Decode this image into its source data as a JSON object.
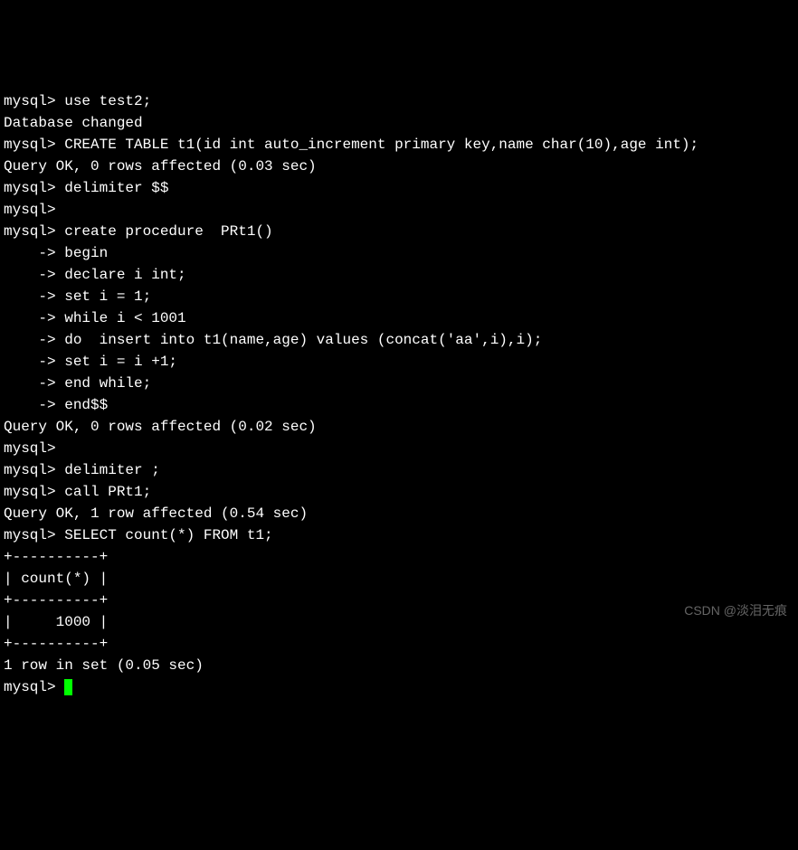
{
  "terminal": {
    "lines": [
      "mysql> use test2;",
      "Database changed",
      "mysql> CREATE TABLE t1(id int auto_increment primary key,name char(10),age int);",
      "Query OK, 0 rows affected (0.03 sec)",
      "",
      "mysql> delimiter $$",
      "mysql>",
      "mysql> create procedure  PRt1()",
      "    -> begin",
      "    -> declare i int;",
      "    -> set i = 1;",
      "    -> while i < 1001",
      "    -> do  insert into t1(name,age) values (concat('aa',i),i);",
      "    -> set i = i +1;",
      "    -> end while;",
      "    -> end$$",
      "Query OK, 0 rows affected (0.02 sec)",
      "",
      "mysql>",
      "mysql> delimiter ;",
      "mysql> call PRt1;",
      "Query OK, 1 row affected (0.54 sec)",
      "",
      "mysql> SELECT count(*) FROM t1;",
      "+----------+",
      "| count(*) |",
      "+----------+",
      "|     1000 |",
      "+----------+",
      "1 row in set (0.05 sec)",
      "",
      "mysql> "
    ]
  },
  "watermark": "CSDN @淡泪无痕"
}
